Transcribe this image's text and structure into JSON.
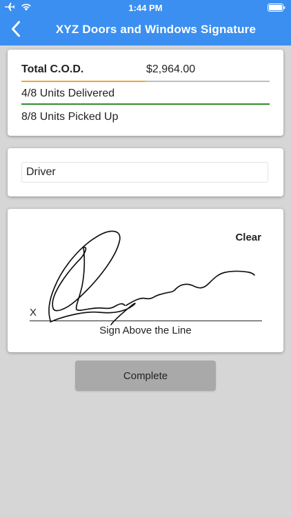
{
  "status_bar": {
    "time": "1:44 PM",
    "icons": [
      "airplane-icon",
      "wifi-icon",
      "battery-icon"
    ]
  },
  "nav": {
    "title": "XYZ Doors and Windows Signature",
    "back_icon": "chevron-left-icon"
  },
  "summary": {
    "cod_label": "Total C.O.D.",
    "cod_amount": "$2,964.00",
    "units_delivered": "4/8 Units Delivered",
    "delivered_progress": 1.0,
    "units_picked_up": "8/8 Units Picked Up"
  },
  "driver": {
    "value": "Driver"
  },
  "signature": {
    "clear_label": "Clear",
    "x_mark": "X",
    "hint": "Sign Above the Line"
  },
  "actions": {
    "complete_label": "Complete"
  },
  "colors": {
    "header": "#3b8ff0",
    "cod_bar": "#f3a32b",
    "delivered_bar": "#2e8b28",
    "background": "#d6d6d6",
    "complete_button": "#a9a9a9"
  }
}
